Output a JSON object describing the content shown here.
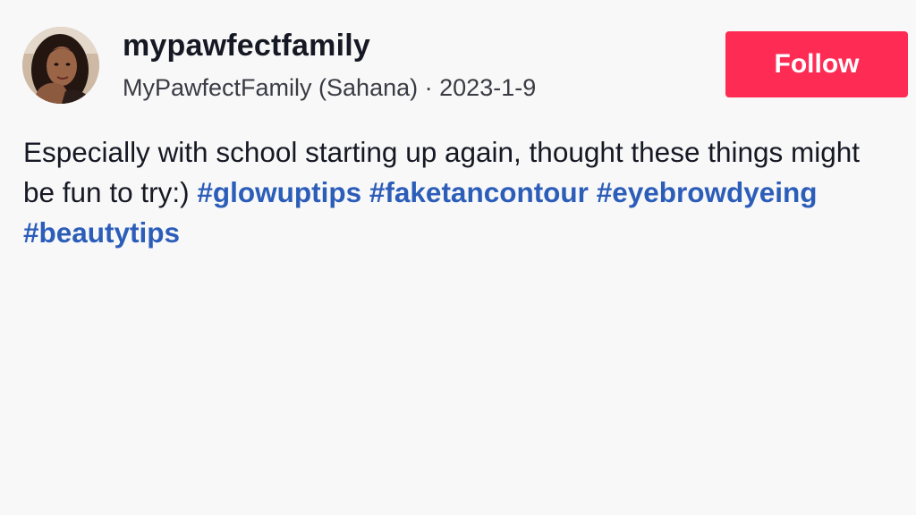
{
  "author": {
    "username": "mypawfectfamily",
    "display_name": "MyPawfectFamily (Sahana)",
    "separator": "·",
    "date": "2023-1-9",
    "avatar_icon": "profile-photo"
  },
  "follow_button": {
    "label": "Follow",
    "color": "#fe2c55"
  },
  "caption": {
    "text": "Especially with school starting up again, thought these things might be fun to try:)",
    "hashtags": [
      "#glowuptips",
      "#faketancontour",
      "#eyebrowdyeing",
      "#beautytips"
    ],
    "hashtag_color": "#2b5db9"
  }
}
